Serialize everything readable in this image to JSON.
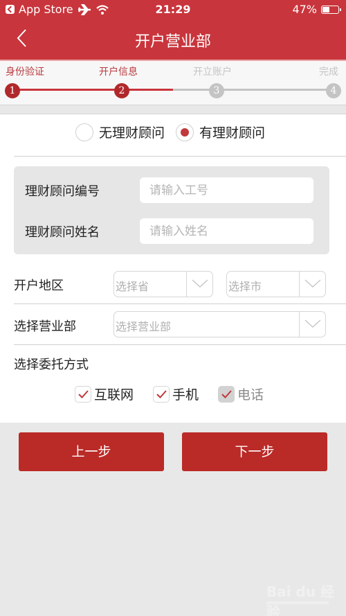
{
  "status_bar": {
    "back_app": "App Store",
    "time": "21:29",
    "battery_percent": "47%",
    "battery_level": 0.47,
    "icons": [
      "airplane-icon",
      "wifi-icon",
      "battery-icon"
    ]
  },
  "nav": {
    "title": "开户营业部",
    "back_icon": "chevron-left-icon"
  },
  "steps": {
    "current": 2,
    "items": [
      {
        "number": "1",
        "label": "身份验证",
        "state": "done"
      },
      {
        "number": "2",
        "label": "开户信息",
        "state": "active"
      },
      {
        "number": "3",
        "label": "开立账户",
        "state": "pending"
      },
      {
        "number": "4",
        "label": "完成",
        "state": "pending"
      }
    ]
  },
  "advisor_choice": {
    "options": [
      {
        "label": "无理财顾问",
        "selected": false
      },
      {
        "label": "有理财顾问",
        "selected": true
      }
    ]
  },
  "advisor_form": {
    "id_label": "理财顾问编号",
    "id_placeholder": "请输入工号",
    "id_value": "",
    "name_label": "理财顾问姓名",
    "name_placeholder": "请输入姓名",
    "name_value": ""
  },
  "region": {
    "label": "开户地区",
    "province_placeholder": "选择省",
    "city_placeholder": "选择市"
  },
  "branch": {
    "label": "选择营业部",
    "placeholder": "选择营业部"
  },
  "delegation": {
    "label": "选择委托方式",
    "options": [
      {
        "label": "互联网",
        "checked": true,
        "disabled": false
      },
      {
        "label": "手机",
        "checked": true,
        "disabled": false
      },
      {
        "label": "电话",
        "checked": true,
        "disabled": true
      }
    ]
  },
  "buttons": {
    "prev": "上一步",
    "next": "下一步"
  },
  "colors": {
    "brand_red": "#c9353c",
    "button_red": "#ba2a27",
    "pending_gray": "#c4c4c4"
  },
  "watermark": "Bai du 经验"
}
